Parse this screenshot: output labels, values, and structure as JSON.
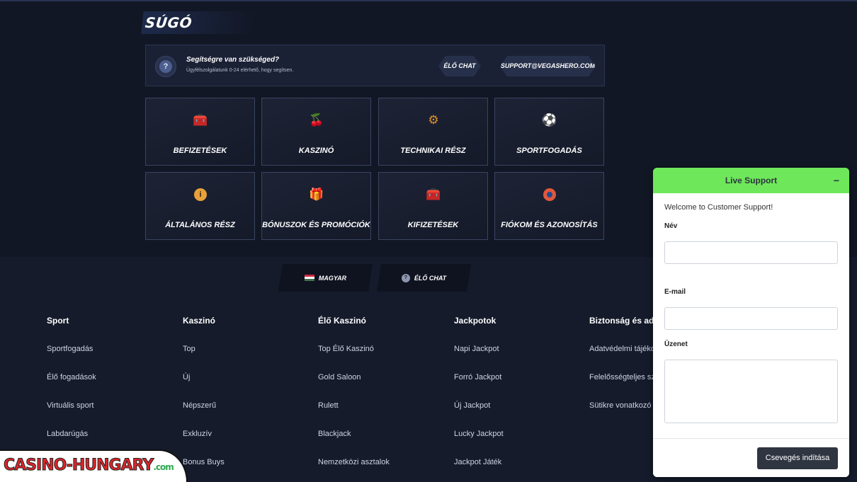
{
  "help": {
    "title": "SÚGÓ",
    "bar": {
      "heading": "Segítségre van szükséged?",
      "subtext": "Ügyfélszolgálatunk 0-24 elérhető, hogy segítsen.",
      "live_chat": "ÉLŐ CHAT",
      "email": "SUPPORT@VEGASHERO.COM"
    },
    "categories": [
      {
        "label": "BEFIZETÉSEK",
        "icon": "treasure-chest-icon"
      },
      {
        "label": "KASZINÓ",
        "icon": "cherries-icon"
      },
      {
        "label": "TECHNIKAI RÉSZ",
        "icon": "gear-icon"
      },
      {
        "label": "SPORTFOGADÁS",
        "icon": "soccer-ball-icon"
      },
      {
        "label": "ÁLTALÁNOS RÉSZ",
        "icon": "info-icon"
      },
      {
        "label": "BÓNUSZOK ÉS PROMÓCIÓK",
        "icon": "gift-box-icon"
      },
      {
        "label": "KIFIZETÉSEK",
        "icon": "treasure-chest-icon"
      },
      {
        "label": "FIÓKOM ÉS AZONOSÍTÁS",
        "icon": "user-icon"
      }
    ]
  },
  "footer": {
    "language": "MAGYAR",
    "live_chat": "ÉLŐ CHAT",
    "columns": [
      {
        "heading": "Sport",
        "links": [
          "Sportfogadás",
          "Élő fogadások",
          "Virtuális sport",
          "Labdarúgás"
        ]
      },
      {
        "heading": "Kaszinó",
        "links": [
          "Top",
          "Új",
          "Népszerű",
          "Exkluzív",
          "Bonus Buys"
        ]
      },
      {
        "heading": "Élő Kaszinó",
        "links": [
          "Top Élő Kaszinó",
          "Gold Saloon",
          "Rulett",
          "Blackjack",
          "Nemzetközi asztalok"
        ]
      },
      {
        "heading": "Jackpotok",
        "links": [
          "Napi Jackpot",
          "Forró Jackpot",
          "Új Jackpot",
          "Lucky Jackpot",
          "Jackpot Játék"
        ]
      },
      {
        "heading": "Biztonság és adat",
        "links": [
          "Adatvédelmi tájékoz",
          "Felelősségteljes sze",
          "Sütikre vonatkozó t"
        ]
      }
    ]
  },
  "watermark": {
    "text_a": "CASINO",
    "text_b": "-HUNGARY",
    "text_c": ".com"
  },
  "widget": {
    "title": "Live Support",
    "minimize": "−",
    "welcome": "Welcome to Customer Support!",
    "name_label": "Név",
    "email_label": "E-mail",
    "message_label": "Üzenet",
    "submit": "Csevegés indítása",
    "accent": "#6ee75a"
  }
}
